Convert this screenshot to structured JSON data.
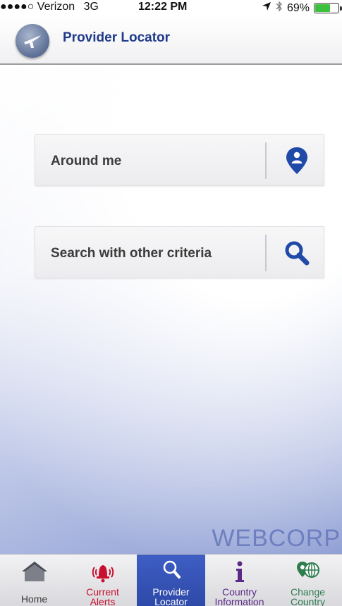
{
  "status_bar": {
    "signal": "●●●●○",
    "carrier": "Verizon",
    "network": "3G",
    "time": "12:22 PM",
    "battery": "69%",
    "battery_level": 0.69
  },
  "header": {
    "title": "Provider Locator"
  },
  "actions": [
    {
      "label": "Around me",
      "icon": "location-pin-icon"
    },
    {
      "label": "Search with other criteria",
      "icon": "search-icon"
    }
  ],
  "watermark": "WEBCORP",
  "tabs": [
    {
      "line1": "Home",
      "line2": "",
      "icon": "home-icon",
      "color": "#3b3b3b",
      "active": false
    },
    {
      "line1": "Current",
      "line2": "Alerts",
      "icon": "alert-bell-icon",
      "color": "#c8102e",
      "active": false
    },
    {
      "line1": "Provider",
      "line2": "Locator",
      "icon": "search-icon",
      "color": "#ffffff",
      "active": true
    },
    {
      "line1": "Country",
      "line2": "Information",
      "icon": "info-icon",
      "color": "#5b2a86",
      "active": false
    },
    {
      "line1": "Change",
      "line2": "Country",
      "icon": "globe-pin-icon",
      "color": "#2e7d4f",
      "active": false
    }
  ],
  "colors": {
    "brand_blue": "#1e3a8a",
    "icon_blue": "#1f4aa8",
    "active_tab": "#3450b4"
  }
}
